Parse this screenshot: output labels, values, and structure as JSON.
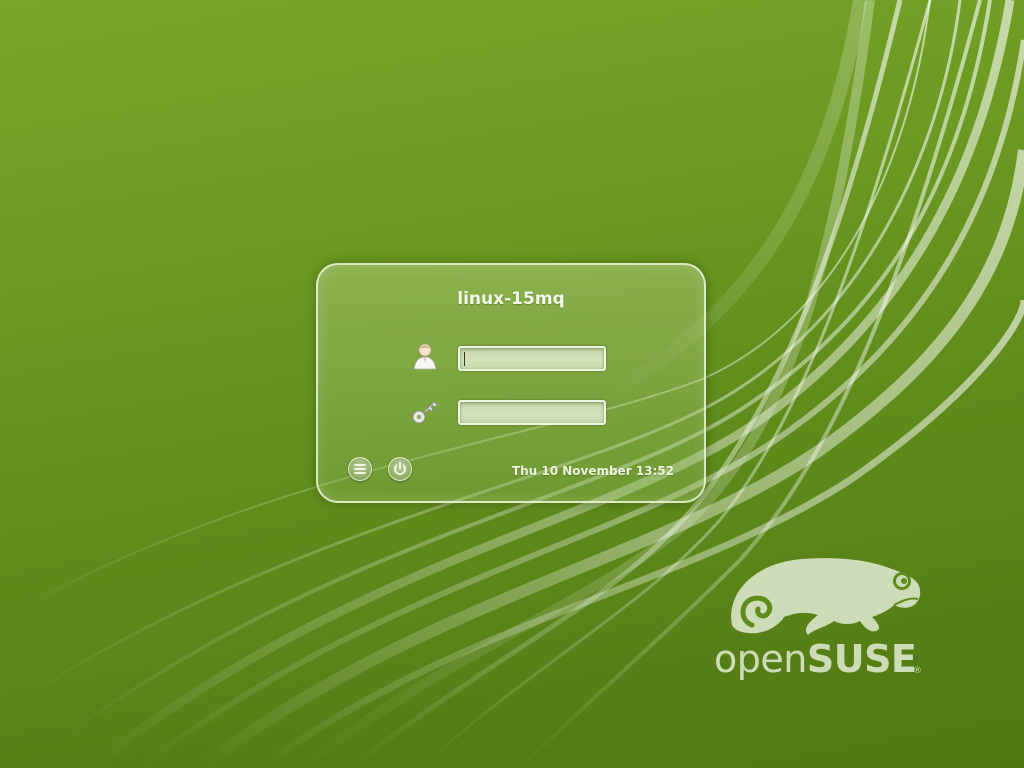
{
  "login": {
    "hostname": "linux-15mq",
    "username_value": "",
    "password_value": "",
    "datetime": "Thu 10 November 13:52"
  },
  "icons": {
    "user": "user-icon",
    "password": "key-icon",
    "menu": "menu-icon",
    "power": "power-icon"
  },
  "branding": {
    "open": "open",
    "suse": "SUSE",
    "registered": "®"
  },
  "colors": {
    "background": "#6c9a22",
    "panel_border": "#ebf5d7",
    "field_fill": "#cfdfb3",
    "logo": "#cddcb6"
  }
}
